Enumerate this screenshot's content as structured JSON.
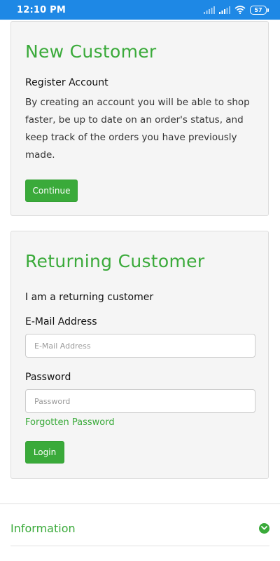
{
  "status_bar": {
    "time": "12:10 PM",
    "battery": "57"
  },
  "new_customer": {
    "title": "New Customer",
    "subtitle": "Register Account",
    "description": "By creating an account you will be able to shop faster, be up to date on an order's status, and keep track of the orders you have previously made.",
    "continue_label": "Continue"
  },
  "returning_customer": {
    "title": "Returning Customer",
    "subtitle": "I am a returning customer",
    "email_label": "E-Mail Address",
    "email_placeholder": "E-Mail Address",
    "email_value": "",
    "password_label": "Password",
    "password_placeholder": "Password",
    "password_value": "",
    "forgot_label": "Forgotten Password",
    "login_label": "Login"
  },
  "footer": {
    "information_label": "Information"
  },
  "colors": {
    "accent": "#3aaa3a",
    "status_bar": "#1e88e5"
  },
  "icons": {
    "signal": "signal-icon",
    "wifi": "wifi-icon",
    "battery": "battery-icon",
    "expand": "chevron-down-circle-icon"
  }
}
